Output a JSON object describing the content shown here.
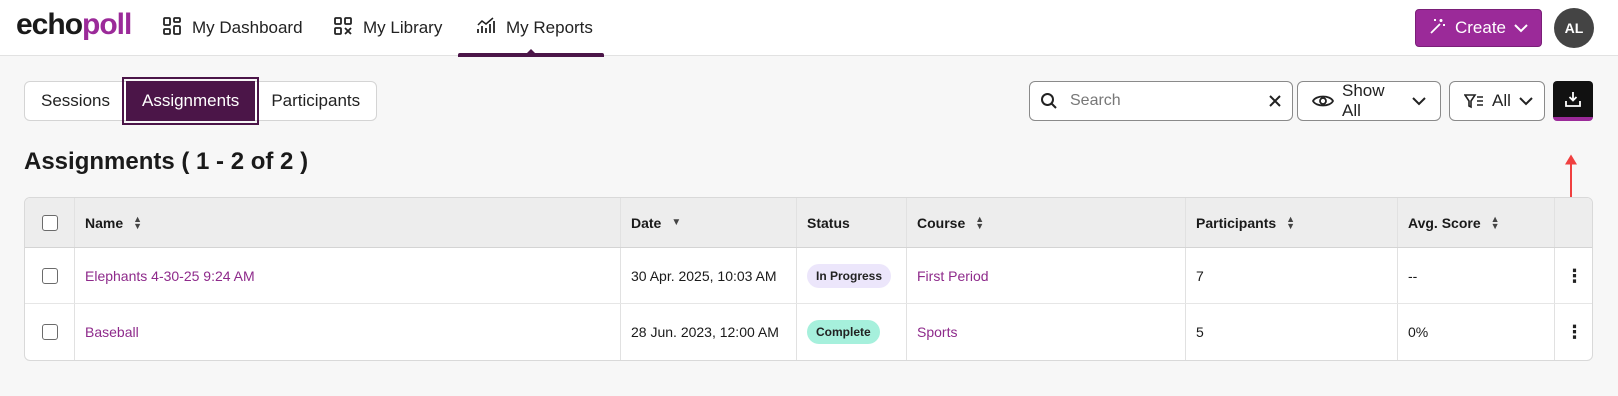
{
  "brand": {
    "part1": "echo",
    "part2": "poll"
  },
  "nav": {
    "items": [
      {
        "label": "My Dashboard",
        "icon": "dashboard-icon"
      },
      {
        "label": "My Library",
        "icon": "library-icon"
      },
      {
        "label": "My Reports",
        "icon": "reports-icon",
        "active": true
      }
    ]
  },
  "header": {
    "create_label": "Create",
    "avatar_initials": "AL"
  },
  "tabs": [
    {
      "label": "Sessions"
    },
    {
      "label": "Assignments",
      "active": true
    },
    {
      "label": "Participants"
    }
  ],
  "toolbar": {
    "search_placeholder": "Search",
    "show_label": "Show All",
    "filter_label": "All"
  },
  "page": {
    "title": "Assignments",
    "range": "( 1 - 2 of 2 )"
  },
  "table": {
    "headers": {
      "name": "Name",
      "date": "Date",
      "status": "Status",
      "course": "Course",
      "participants": "Participants",
      "avg_score": "Avg. Score"
    },
    "rows": [
      {
        "name": "Elephants 4-30-25 9:24 AM",
        "date": "30 Apr. 2025, 10:03 AM",
        "status": "In Progress",
        "course": "First Period",
        "participants": "7",
        "avg_score": "--"
      },
      {
        "name": "Baseball",
        "date": "28 Jun. 2023, 12:00 AM",
        "status": "Complete",
        "course": "Sports",
        "participants": "5",
        "avg_score": "0%"
      }
    ]
  },
  "colors": {
    "brand_purple": "#9b2a99",
    "dark_purple": "#4b1548",
    "in_progress_bg": "#ece6fb",
    "complete_bg": "#a6f0dc",
    "annotation_arrow": "#f04040"
  }
}
